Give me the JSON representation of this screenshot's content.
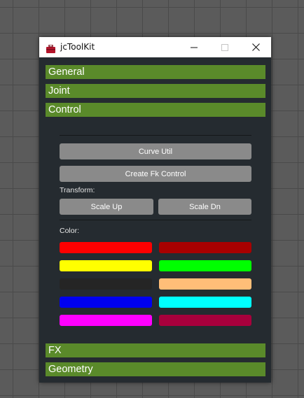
{
  "window": {
    "title": "jcToolKit",
    "icons": {
      "app": "toolbox-icon",
      "minimize": "minimize-icon",
      "maximize": "maximize-icon",
      "close": "close-icon"
    }
  },
  "sections": {
    "general": "General",
    "joint": "Joint",
    "control": "Control",
    "fx": "FX",
    "geometry": "Geometry"
  },
  "control_panel": {
    "curve_util": "Curve Util",
    "create_fk_control": "Create Fk Control",
    "transform_label": "Transform:",
    "scale_up": "Scale Up",
    "scale_dn": "Scale Dn",
    "color_label": "Color:",
    "colors": {
      "red": "#ff0000",
      "dark_red": "#a80000",
      "yellow": "#ffff00",
      "green": "#00ff00",
      "black": "#252525",
      "orange": "#ffbe78",
      "blue": "#0000f0",
      "cyan": "#00ffff",
      "magenta": "#ff00ff",
      "maroon": "#a8003c"
    }
  },
  "theme": {
    "section_header_color": "#5a8a2a",
    "panel_background": "#252b30",
    "button_color": "#8a8a8a"
  }
}
